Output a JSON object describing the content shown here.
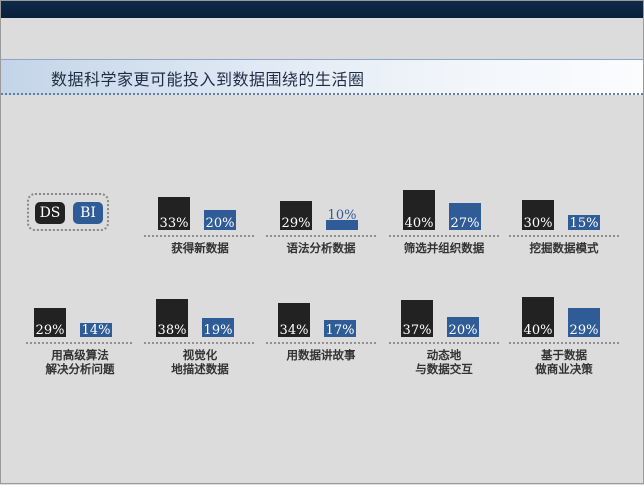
{
  "slide": {
    "title": "数据科学家更可能投入到数据围绕的生活圈"
  },
  "legend": {
    "ds": "DS",
    "bi": "BI"
  },
  "colors": {
    "ds": "#222222",
    "bi": "#2f5c96",
    "title_band_start": "#c4d4e8",
    "top_bar": "#0f2a4a"
  },
  "chart_data": {
    "type": "bar",
    "series": [
      {
        "name": "DS",
        "values": [
          33,
          29,
          40,
          30,
          29,
          38,
          34,
          37,
          40
        ]
      },
      {
        "name": "BI",
        "values": [
          20,
          10,
          27,
          15,
          14,
          19,
          17,
          20,
          29
        ]
      }
    ],
    "categories": [
      [
        "获得新数据"
      ],
      [
        "语法分析数据"
      ],
      [
        "筛选并组织数据"
      ],
      [
        "挖掘数据模式"
      ],
      [
        "用高级算法",
        "解决分析问题"
      ],
      [
        "视觉化",
        "地描述数据"
      ],
      [
        "用数据讲故事"
      ],
      [
        "动态地",
        "与数据交互"
      ],
      [
        "基于数据",
        "做商业决策"
      ]
    ],
    "labels": [
      [
        "33%",
        "20%"
      ],
      [
        "29%",
        "10%"
      ],
      [
        "40%",
        "27%"
      ],
      [
        "30%",
        "15%"
      ],
      [
        "29%",
        "14%"
      ],
      [
        "38%",
        "19%"
      ],
      [
        "34%",
        "17%"
      ],
      [
        "37%",
        "20%"
      ],
      [
        "40%",
        "29%"
      ]
    ],
    "legend_position": "left",
    "grid": false
  }
}
